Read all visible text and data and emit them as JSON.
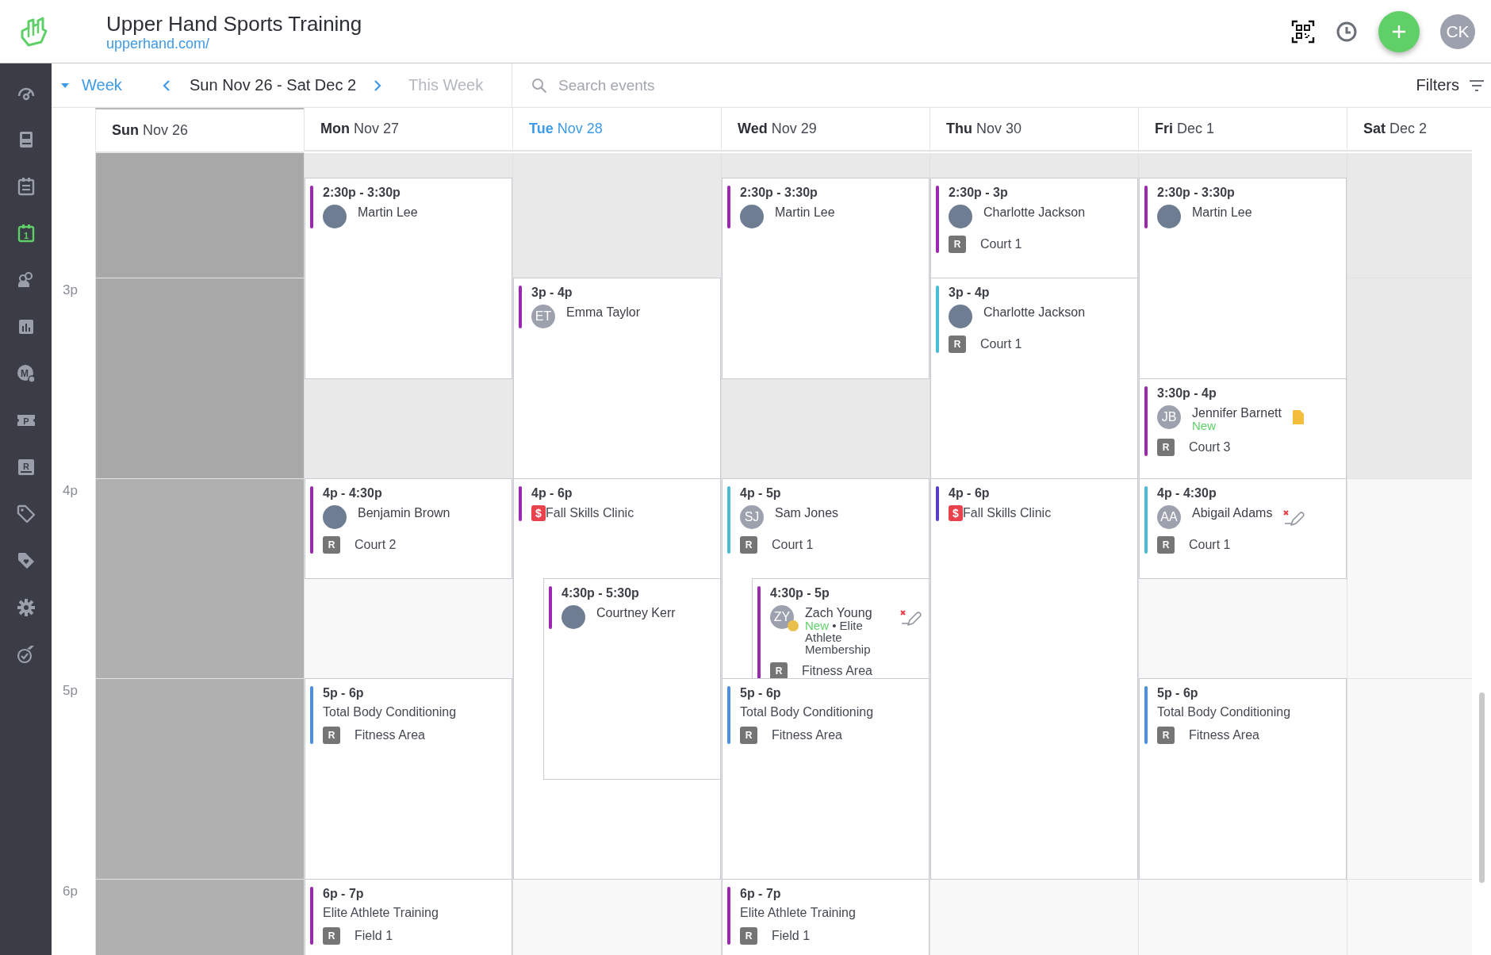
{
  "header": {
    "title": "Upper Hand Sports Training",
    "url": "upperhand.com/",
    "user_initials": "CK"
  },
  "sidebar": {
    "items": [
      {
        "selected": false
      },
      {
        "selected": false
      },
      {
        "selected": false
      },
      {
        "glyph": "1",
        "selected": true
      },
      {
        "selected": false
      },
      {
        "selected": false
      },
      {
        "glyph": "M",
        "selected": false
      },
      {
        "glyph": "P",
        "selected": false
      },
      {
        "glyph": "R",
        "selected": false
      },
      {
        "selected": false
      },
      {
        "selected": false
      },
      {
        "selected": false
      },
      {
        "selected": false
      }
    ]
  },
  "toolbar": {
    "view": "Week",
    "range": "Sun Nov 26 - Sat Dec 2",
    "this_week": {
      "label": "This Week",
      "disabled": true
    },
    "search": {
      "placeholder": "Search events"
    },
    "filters": "Filters"
  },
  "time_labels": [
    "3p",
    "4p",
    "5p",
    "6p"
  ],
  "days": [
    {
      "dow": "Sun",
      "date": "Nov 26",
      "today": false,
      "closed": true
    },
    {
      "dow": "Mon",
      "date": "Nov 27",
      "today": false,
      "closed": false,
      "events": [
        {
          "time": "2:30p - 3:30p",
          "color": "#9c27b0",
          "person": {
            "name": "Martin Lee",
            "note": false,
            "waiver": false
          }
        },
        {
          "time": "4p - 4:30p",
          "color": "#9c27b0",
          "person": {
            "name": "Benjamin Brown",
            "note": false,
            "waiver": false
          },
          "resource": {
            "badge": "R",
            "name": "Court 2"
          }
        },
        {
          "time": "5p - 6p",
          "color": "#4a90e2",
          "title": "Total Body Conditioning",
          "resource": {
            "badge": "R",
            "name": "Fitness Area"
          }
        },
        {
          "time": "6p - 7p",
          "color": "#9c27b0",
          "title": "Elite Athlete Training",
          "resource": {
            "badge": "R",
            "name": "Field 1"
          }
        }
      ]
    },
    {
      "dow": "Tue",
      "date": "Nov 28",
      "today": true,
      "closed": false,
      "events": [
        {
          "time": "3p - 4p",
          "color": "#9c27b0",
          "person": {
            "initials": "ET",
            "name": "Emma Taylor",
            "alert": false,
            "note": false,
            "waiver": false
          }
        },
        {
          "time": "4p - 6p",
          "color": "#9c27b0",
          "price_badge": "$",
          "title": "Fall Skills Clinic"
        },
        {
          "time": "4:30p - 5:30p",
          "color": "#9c27b0",
          "person": {
            "name": "Courtney Kerr",
            "note": false,
            "waiver": false
          }
        }
      ]
    },
    {
      "dow": "Wed",
      "date": "Nov 29",
      "today": false,
      "closed": false,
      "events": [
        {
          "time": "2:30p - 3:30p",
          "color": "#9c27b0",
          "person": {
            "name": "Martin Lee",
            "note": false,
            "waiver": false
          }
        },
        {
          "time": "4p - 5p",
          "color": "#4bbcd6",
          "person": {
            "initials": "SJ",
            "name": "Sam Jones",
            "alert": false,
            "note": false,
            "waiver": false
          },
          "resource": {
            "badge": "R",
            "name": "Court 1"
          }
        },
        {
          "time": "4:30p - 5p",
          "color": "#9c27b0",
          "person": {
            "initials": "ZY",
            "name": "Zach Young",
            "alert": true,
            "status": "New",
            "separator": "•",
            "membership": "Elite Athlete Membership",
            "note": false,
            "waiver": true
          },
          "resource": {
            "badge": "R",
            "name": "Fitness Area"
          }
        },
        {
          "time": "5p - 6p",
          "color": "#4a90e2",
          "title": "Total Body Conditioning",
          "resource": {
            "badge": "R",
            "name": "Fitness Area"
          }
        },
        {
          "time": "6p - 7p",
          "color": "#9c27b0",
          "title": "Elite Athlete Training",
          "resource": {
            "badge": "R",
            "name": "Field 1"
          }
        }
      ]
    },
    {
      "dow": "Thu",
      "date": "Nov 30",
      "today": false,
      "closed": false,
      "events": [
        {
          "time": "2:30p - 3p",
          "color": "#9c27b0",
          "person": {
            "name": "Charlotte Jackson",
            "note": false,
            "waiver": false
          },
          "resource": {
            "badge": "R",
            "name": "Court 1"
          }
        },
        {
          "time": "3p - 4p",
          "color": "#4bbcd6",
          "person": {
            "name": "Charlotte Jackson",
            "note": false,
            "waiver": false
          },
          "resource": {
            "badge": "R",
            "name": "Court 1"
          }
        },
        {
          "time": "4p - 6p",
          "color": "#5b3cc4",
          "price_badge": "$",
          "title": "Fall Skills Clinic"
        }
      ]
    },
    {
      "dow": "Fri",
      "date": "Dec 1",
      "today": false,
      "closed": false,
      "events": [
        {
          "time": "2:30p - 3:30p",
          "color": "#9c27b0",
          "person": {
            "name": "Martin Lee",
            "note": false,
            "waiver": false
          }
        },
        {
          "time": "3:30p - 4p",
          "color": "#9c27b0",
          "person": {
            "initials": "JB",
            "name": "Jennifer Barnett",
            "alert": false,
            "status": "New",
            "note": true,
            "waiver": false
          },
          "resource": {
            "badge": "R",
            "name": "Court 3"
          }
        },
        {
          "time": "4p - 4:30p",
          "color": "#4bbcd6",
          "person": {
            "initials": "AA",
            "name": "Abigail Adams",
            "alert": false,
            "note": false,
            "waiver": true
          },
          "resource": {
            "badge": "R",
            "name": "Court 1"
          }
        },
        {
          "time": "5p - 6p",
          "color": "#4a90e2",
          "title": "Total Body Conditioning",
          "resource": {
            "badge": "R",
            "name": "Fitness Area"
          }
        }
      ]
    },
    {
      "dow": "Sat",
      "date": "Dec 2",
      "today": false,
      "closed": false
    }
  ]
}
